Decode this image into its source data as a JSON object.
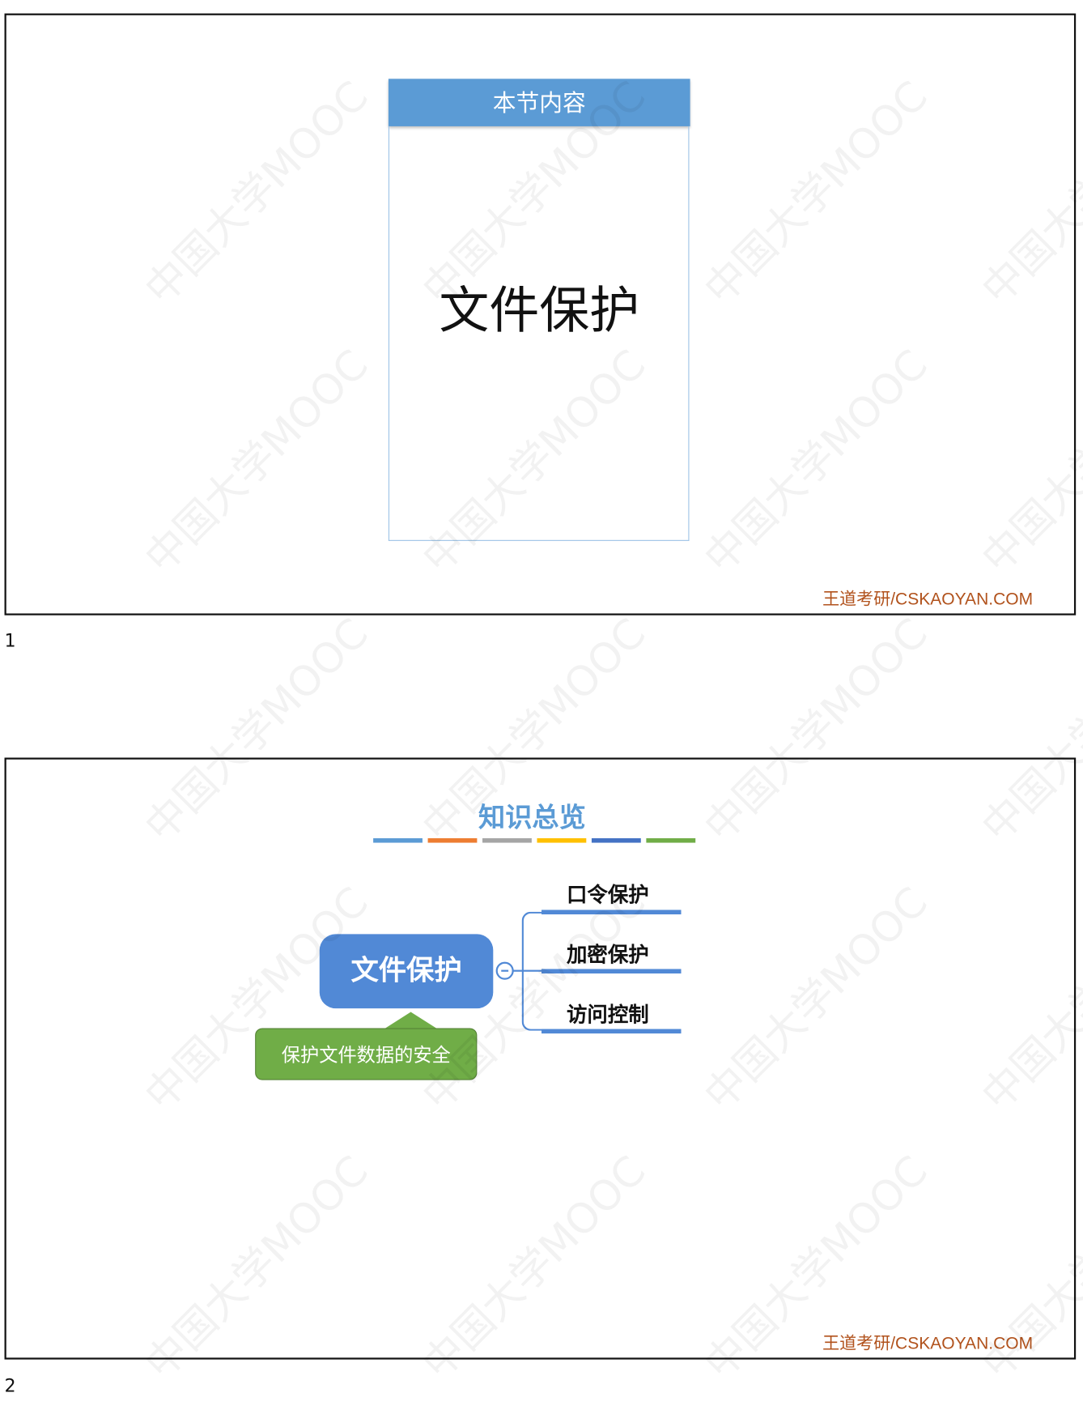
{
  "watermark": "中国大学MOOC",
  "slides": [
    {
      "header": "本节内容",
      "main_text": "文件保护",
      "footer": "王道考研/CSKAOYAN.COM",
      "page_number": "1"
    },
    {
      "title": "知识总览",
      "title_bar_colors": [
        "#5b9bd5",
        "#ed7d31",
        "#a5a5a5",
        "#ffc000",
        "#4472c4",
        "#70ad47"
      ],
      "mindmap": {
        "root": "文件保护",
        "note": "保护文件数据的安全",
        "branches": [
          "口令保护",
          "加密保护",
          "访问控制"
        ]
      },
      "footer": "王道考研/CSKAOYAN.COM",
      "page_number": "2"
    }
  ]
}
